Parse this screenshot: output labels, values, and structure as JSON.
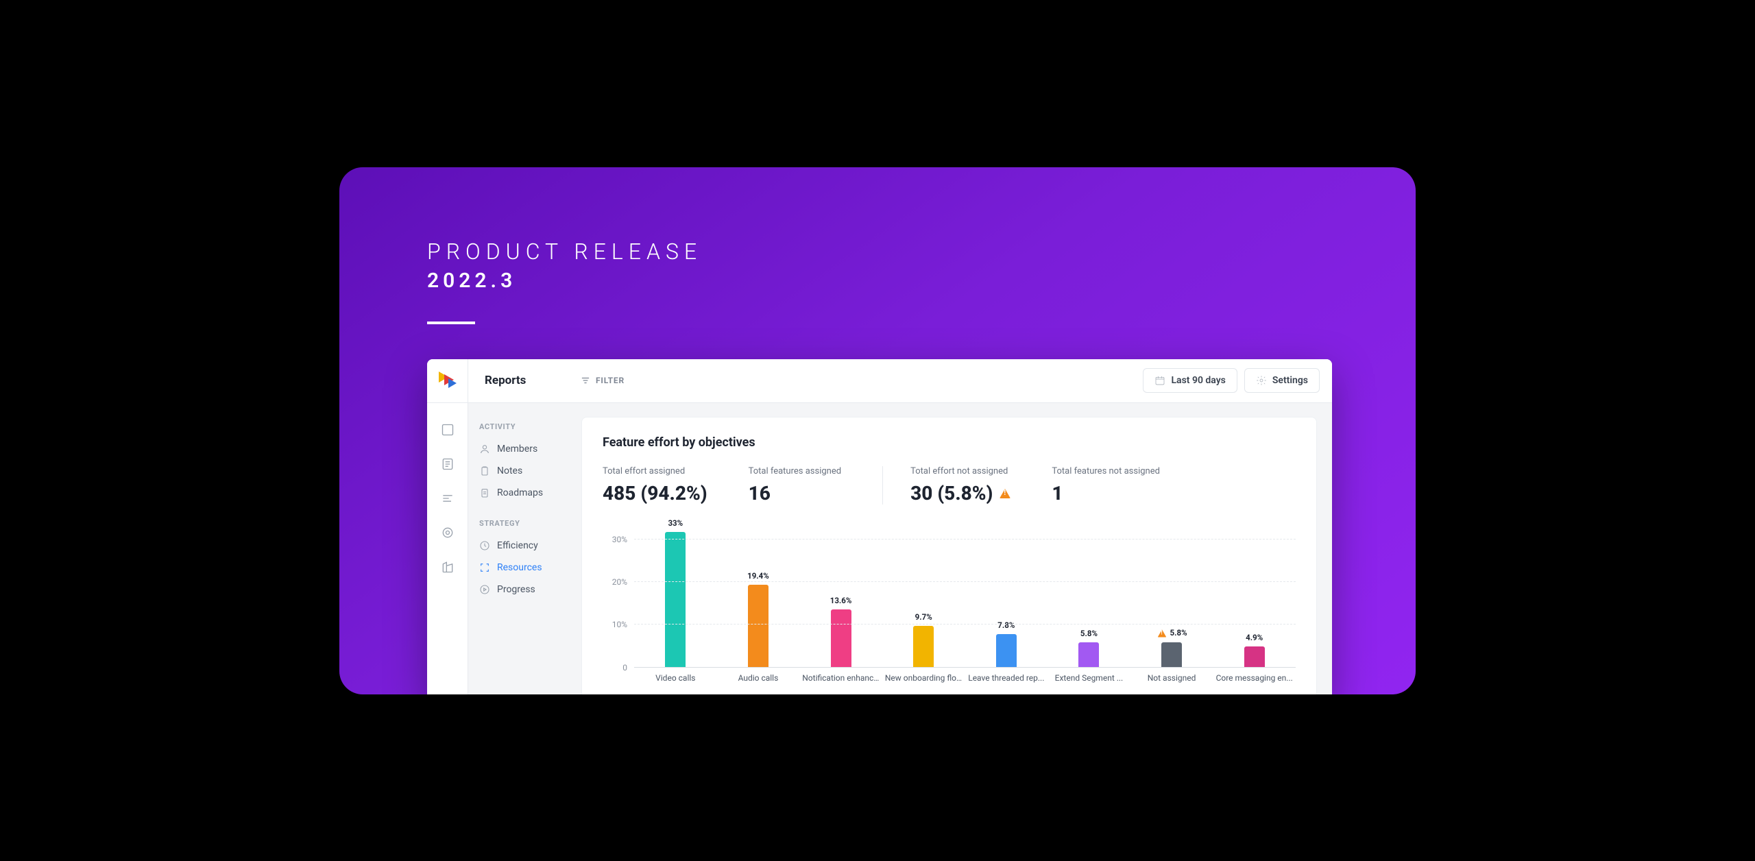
{
  "overlay": {
    "line1": "PRODUCT RELEASE",
    "line2": "2022.3"
  },
  "header": {
    "page_title": "Reports",
    "filter_label": "FILTER",
    "date_range_label": "Last 90 days",
    "settings_label": "Settings"
  },
  "rail": {
    "items": [
      {
        "name": "board-icon"
      },
      {
        "name": "notes-icon"
      },
      {
        "name": "lines-icon"
      },
      {
        "name": "target-icon"
      },
      {
        "name": "building-icon"
      }
    ]
  },
  "sidebar": {
    "groups": [
      {
        "label": "ACTIVITY",
        "items": [
          {
            "name": "members",
            "label": "Members",
            "icon": "user-icon"
          },
          {
            "name": "notes",
            "label": "Notes",
            "icon": "clipboard-icon"
          },
          {
            "name": "roadmaps",
            "label": "Roadmaps",
            "icon": "clipboard-list-icon"
          }
        ]
      },
      {
        "label": "STRATEGY",
        "items": [
          {
            "name": "efficiency",
            "label": "Efficiency",
            "icon": "clock-icon"
          },
          {
            "name": "resources",
            "label": "Resources",
            "icon": "focus-icon",
            "active": true
          },
          {
            "name": "progress",
            "label": "Progress",
            "icon": "play-circle-icon"
          }
        ]
      }
    ]
  },
  "panel": {
    "title": "Feature effort by objectives",
    "metrics": [
      {
        "label": "Total effort assigned",
        "value": "485 (94.2%)"
      },
      {
        "label": "Total features assigned",
        "value": "16"
      },
      {
        "label": "Total effort not assigned",
        "value": "30 (5.8%)",
        "warn": true
      },
      {
        "label": "Total features not assigned",
        "value": "1"
      }
    ]
  },
  "chart_data": {
    "type": "bar",
    "title": "Feature effort by objectives",
    "xlabel": "",
    "ylabel": "",
    "ylim": [
      0,
      35
    ],
    "yticks": [
      0,
      10,
      20,
      30
    ],
    "ytick_labels": [
      "0",
      "10%",
      "20%",
      "30%"
    ],
    "categories": [
      "Video calls",
      "Audio calls",
      "Notification enhanc...",
      "New onboarding flow",
      "Leave threaded rep...",
      "Extend Segment ...",
      "Not assigned",
      "Core messaging en..."
    ],
    "values": [
      33,
      19.4,
      13.6,
      9.7,
      7.8,
      5.8,
      5.8,
      4.9
    ],
    "value_labels": [
      "33%",
      "19.4%",
      "13.6%",
      "9.7%",
      "7.8%",
      "5.8%",
      "5.8%",
      "4.9%"
    ],
    "colors": [
      "#1cc7b3",
      "#f38b1c",
      "#ef3e84",
      "#f2b400",
      "#3c92f2",
      "#a259f2",
      "#5b6470",
      "#d63384"
    ],
    "warn_index": 6
  }
}
